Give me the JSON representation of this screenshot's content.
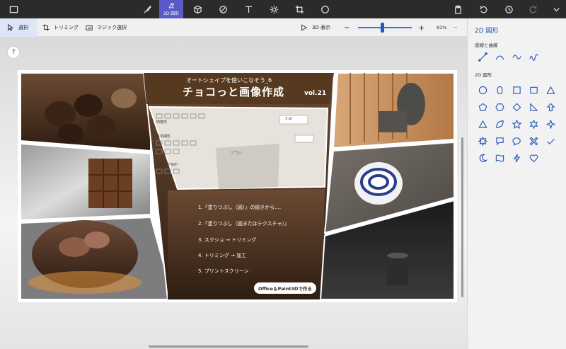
{
  "toolbar": {
    "active_label": "2D 図形"
  },
  "subbar": {
    "select_label": "選択",
    "crop_label": "トリミング",
    "magic_select_label": "マジック選択",
    "view3d_label": "3D 表示",
    "zoom_minus": "−",
    "zoom_plus": "+",
    "zoom_level": "91%",
    "zoom_fraction": 0.45,
    "more": "···"
  },
  "canvas": {
    "help": "?"
  },
  "artwork": {
    "subtitle": "オートシェイプを使いこなそう_6",
    "title": "チョコっと画像作成",
    "version": "vol.21",
    "steps": [
      "1.『塗りつぶし（図）』の続きから....",
      "2.『塗りつぶし（図またはテクスチャ）』",
      "3. スクショ → トリミング",
      "4. トリミング → 加工",
      "5. プリントスクリーン"
    ],
    "badge": "Office＆Paint3Dで作る",
    "ui_labels": {
      "frame": "四角形",
      "basic": "基本図形",
      "block": "ブロック矢印",
      "brush": "ブラシ",
      "pt": "3 pt"
    }
  },
  "panel": {
    "title": "2D 図形",
    "lines_title": "直線と曲線",
    "shapes_title": "2D 図形"
  },
  "colors": {
    "accent": "#5a59c8",
    "panel_blue": "#2453b8",
    "chocolate": "#4a2a12"
  }
}
